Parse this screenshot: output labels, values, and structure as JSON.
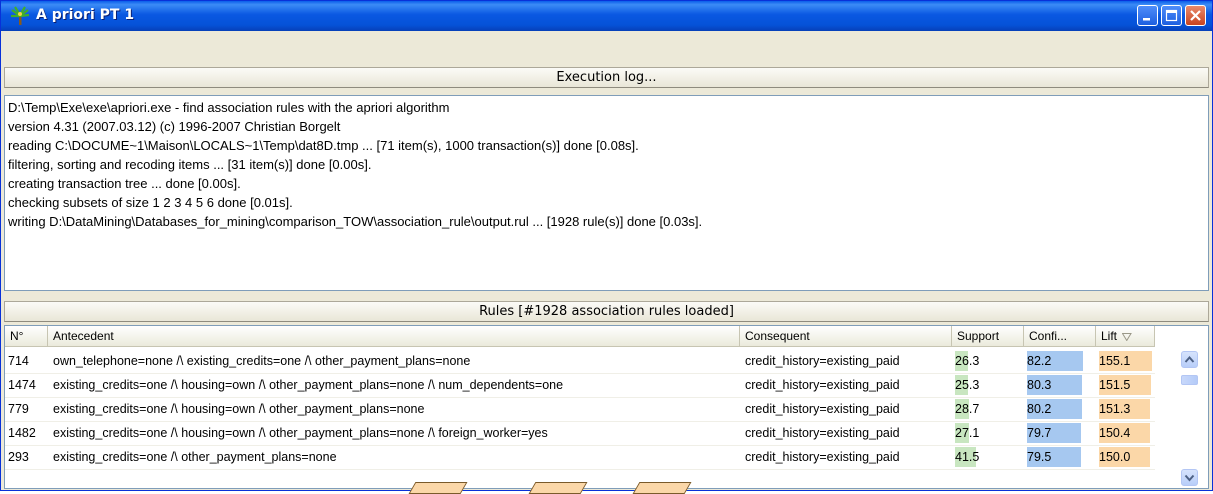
{
  "window": {
    "title": "A priori PT 1",
    "icons": {
      "app": "tree-icon",
      "minimize": "minimize-icon",
      "maximize": "maximize-icon",
      "close": "close-icon"
    }
  },
  "log": {
    "header": "Execution log...",
    "lines": [
      "D:\\Temp\\Exe\\exe\\apriori.exe - find association rules with the apriori algorithm",
      "version 4.31 (2007.03.12)      (c) 1996-2007   Christian Borgelt",
      "reading C:\\DOCUME~1\\Maison\\LOCALS~1\\Temp\\dat8D.tmp ... [71 item(s), 1000 transaction(s)] done [0.08s].",
      "filtering, sorting and recoding items ... [31 item(s)] done [0.00s].",
      "creating transaction tree ... done [0.00s].",
      "checking subsets of size 1 2 3 4 5 6 done [0.01s].",
      "writing D:\\DataMining\\Databases_for_mining\\comparison_TOW\\association_rule\\output.rul ... [1928 rule(s)] done [0.03s]."
    ]
  },
  "rules": {
    "header": "Rules [#1928 association rules loaded]",
    "columns": {
      "num": "N°",
      "antecedent": "Antecedent",
      "consequent": "Consequent",
      "support": "Support",
      "confidence": "Confi...",
      "lift": "Lift",
      "lift_sort_icon": "sort-desc-icon"
    },
    "colors": {
      "support": "#c8e6c0",
      "confidence": "#a6c8f0",
      "lift": "#fbd7a8"
    },
    "rows": [
      {
        "num": "714",
        "antecedent": "own_telephone=none /\\ existing_credits=one /\\ other_payment_plans=none",
        "consequent": "credit_history=existing_paid",
        "support": "26.3",
        "confidence": "82.2",
        "lift": "155.1"
      },
      {
        "num": "1474",
        "antecedent": "existing_credits=one /\\ housing=own /\\ other_payment_plans=none /\\ num_dependents=one",
        "consequent": "credit_history=existing_paid",
        "support": "25.3",
        "confidence": "80.3",
        "lift": "151.5"
      },
      {
        "num": "779",
        "antecedent": "existing_credits=one /\\ housing=own /\\ other_payment_plans=none",
        "consequent": "credit_history=existing_paid",
        "support": "28.7",
        "confidence": "80.2",
        "lift": "151.3"
      },
      {
        "num": "1482",
        "antecedent": "existing_credits=one /\\ housing=own /\\ other_payment_plans=none /\\ foreign_worker=yes",
        "consequent": "credit_history=existing_paid",
        "support": "27.1",
        "confidence": "79.7",
        "lift": "150.4"
      },
      {
        "num": "293",
        "antecedent": "existing_credits=one /\\ other_payment_plans=none",
        "consequent": "credit_history=existing_paid",
        "support": "41.5",
        "confidence": "79.5",
        "lift": "150.0"
      }
    ]
  }
}
